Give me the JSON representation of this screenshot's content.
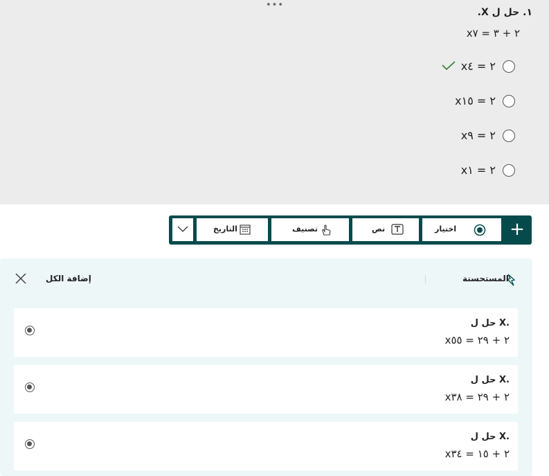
{
  "question": {
    "more_glyph": "•••",
    "title": "١. حل ل X.",
    "equation": "x٢ + ٣ = ٧",
    "options": [
      {
        "text": "x٢ = ٤",
        "correct": true
      },
      {
        "text": "x٢ = ١٥",
        "correct": false
      },
      {
        "text": "x٢ = ٩",
        "correct": false
      },
      {
        "text": "x٢ = ١",
        "correct": false
      }
    ],
    "correct_color": "#2e7d32"
  },
  "toolbar": {
    "bg_color": "#054b4c",
    "add_label": "+",
    "items": [
      {
        "label": "اختيار",
        "icon": "radio-choice-icon"
      },
      {
        "label": "نص",
        "icon": "text-box-icon"
      },
      {
        "label": "تصنيف",
        "icon": "hand-rating-icon"
      },
      {
        "label": "التاريخ",
        "icon": "calendar-icon"
      }
    ],
    "more_icon": "chevron-down-icon"
  },
  "suggestions": {
    "title": "المستحسنة",
    "add_all": "إضافة الكل",
    "items": [
      {
        "title": "حل ل X.",
        "equation": "x٢ + ٢٩ = ٥٥"
      },
      {
        "title": "حل ل X.",
        "equation": "x٢ + ٢٩ = ٣٨"
      },
      {
        "title": "حل ل X.",
        "equation": "x٢ + ١٥ = ٣٤"
      }
    ]
  }
}
